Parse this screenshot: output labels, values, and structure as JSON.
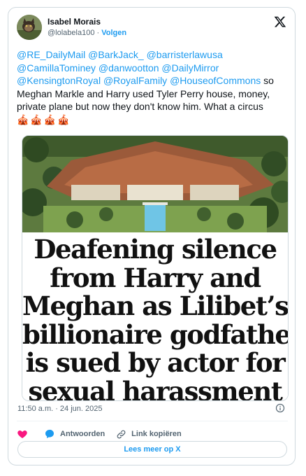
{
  "author": {
    "name": "Isabel Morais",
    "handle": "@lolabela100",
    "separator": "·",
    "follow_label": "Volgen"
  },
  "tweet": {
    "mentions_line1": [
      "@RE_DailyMail",
      "@BarkJack_",
      "@barristerlawusa"
    ],
    "mentions_line2": [
      "@CamillaTominey",
      "@danwootton",
      "@DailyMirror"
    ],
    "mentions_line3": [
      "@KensingtonRoyal",
      "@RoyalFamily",
      "@HouseofCommons"
    ],
    "text_after_mentions": "so Meghan Markle and Harry used Tyler Perry house, money, private plane but now they don't know him. What a circus",
    "emojis": "🎪🎪🎪🎪"
  },
  "media": {
    "headline_lines": [
      "Deafening silence",
      "from Harry and",
      "Meghan as Lilibet’s",
      "billionaire godfather",
      "is sued by actor for",
      "sexual harassment"
    ]
  },
  "meta": {
    "timestamp": "11:50 a.m. · 24 jun. 2025"
  },
  "actions": {
    "reply_label": "Antwoorden",
    "copy_link_label": "Link kopiëren",
    "read_more_label": "Lees meer op X"
  },
  "colors": {
    "accent": "#1d9bf0",
    "like": "#f91880",
    "text": "#0f1419",
    "muted": "#536471"
  }
}
